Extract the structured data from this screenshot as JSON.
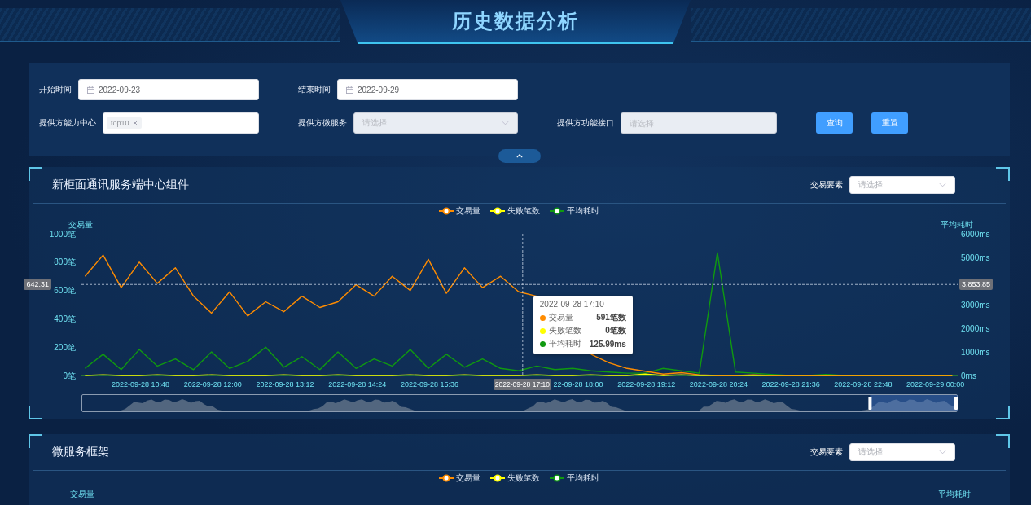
{
  "header": {
    "title": "历史数据分析"
  },
  "filters": {
    "fields": [
      {
        "label": "开始时间",
        "kind": "date",
        "value": "2022-09-23",
        "disabled": false
      },
      {
        "label": "结束时间",
        "kind": "date",
        "value": "2022-09-29",
        "disabled": false
      },
      {
        "label": "提供方能力中心",
        "kind": "tags",
        "tags": [
          "top10"
        ],
        "disabled": false
      },
      {
        "label": "提供方微服务",
        "kind": "select",
        "placeholder": "请选择",
        "disabled": true
      },
      {
        "label": "提供方功能接口",
        "kind": "input",
        "placeholder": "请选择",
        "disabled": true
      }
    ],
    "buttons": [
      "查询",
      "重置"
    ]
  },
  "panels": [
    {
      "title": "新柜面通讯服务端中心组件",
      "select": {
        "label": "交易要素",
        "placeholder": "请选择"
      },
      "chart": {
        "chart_data": {
          "type": "line",
          "legend": "top",
          "ylabel": "交易量",
          "y2label": "平均耗时",
          "ylim": [
            0,
            1000
          ],
          "y2lim": [
            0,
            6000
          ],
          "yticks": [
            {
              "value": 0,
              "label": "0笔"
            },
            {
              "value": 200,
              "label": "200笔"
            },
            {
              "value": 400,
              "label": "400笔"
            },
            {
              "value": 600,
              "label": "600笔"
            },
            {
              "value": 800,
              "label": "800笔"
            },
            {
              "value": 1000,
              "label": "1000笔"
            }
          ],
          "y2ticks": [
            {
              "value": 0,
              "label": "0ms"
            },
            {
              "value": 1000,
              "label": "1000ms"
            },
            {
              "value": 2000,
              "label": "2000ms"
            },
            {
              "value": 3000,
              "label": "3000ms"
            },
            {
              "value": 5000,
              "label": "5000ms"
            },
            {
              "value": 6000,
              "label": "6000ms"
            }
          ],
          "categories": [
            null,
            null,
            null,
            "2022-09-28 10:48",
            null,
            null,
            null,
            "2022-09-28 12:00",
            null,
            null,
            null,
            "2022-09-28 13:12",
            null,
            null,
            null,
            "2022-09-28 14:24",
            null,
            null,
            null,
            "2022-09-28 15:36",
            null,
            null,
            null,
            null,
            null,
            null,
            null,
            "22-09-28 18:00",
            null,
            null,
            null,
            "2022-09-28 19:12",
            null,
            null,
            null,
            "2022-09-28 20:24",
            null,
            null,
            null,
            "2022-09-28 21:36",
            null,
            null,
            null,
            "2022-09-28 22:48",
            null,
            null,
            null,
            "2022-09-29 00:00",
            null
          ],
          "series": [
            {
              "name": "交易量",
              "color": "#ff8c00",
              "values": [
                700,
                850,
                620,
                800,
                650,
                760,
                560,
                440,
                590,
                420,
                520,
                450,
                560,
                480,
                520,
                640,
                560,
                700,
                600,
                820,
                580,
                760,
                620,
                700,
                591,
                560,
                null,
                null,
                150,
                90,
                50,
                30,
                10,
                20,
                5,
                0,
                0,
                5,
                0,
                0,
                0,
                0,
                0,
                0,
                0,
                0,
                0,
                0,
                0
              ]
            },
            {
              "name": "失败笔数",
              "color": "#ffff00",
              "values": [
                0,
                5,
                0,
                0,
                5,
                0,
                0,
                5,
                0,
                0,
                0,
                5,
                0,
                0,
                5,
                0,
                0,
                0,
                5,
                0,
                0,
                5,
                0,
                0,
                0,
                5,
                0,
                0,
                5,
                0,
                0,
                10,
                0,
                5,
                0,
                0,
                0,
                0,
                0,
                0,
                0,
                0,
                0,
                0,
                0,
                0,
                0,
                0,
                0
              ]
            },
            {
              "name": "平均耗时",
              "color": "#109a10",
              "axis": "y2",
              "values": [
                300,
                900,
                250,
                1100,
                400,
                700,
                250,
                1000,
                300,
                600,
                1200,
                350,
                800,
                250,
                1000,
                300,
                700,
                400,
                1100,
                300,
                900,
                350,
                700,
                300,
                200,
                400,
                250,
                300,
                200,
                150,
                100,
                100,
                300,
                200,
                100,
                5200,
                150,
                100,
                50,
                0,
                0,
                50,
                0,
                0,
                0,
                0,
                0,
                0,
                0
              ]
            }
          ]
        }
      },
      "axis_pointer": {
        "x_label": "2022-09-28 17:10",
        "y_label": "642.31",
        "y2_label": "3,853.85"
      },
      "tooltip": {
        "title": "2022-09-28 17:10",
        "rows": [
          {
            "name": "交易量",
            "value": "591笔数",
            "color": "#ff8c00"
          },
          {
            "name": "失败笔数",
            "value": "0笔数",
            "color": "#ffff00"
          },
          {
            "name": "平均耗时",
            "value": "125.99ms",
            "color": "#109a10"
          }
        ]
      },
      "zoom_slider": {
        "level": 0.9
      }
    },
    {
      "title": "微服务框架",
      "select": {
        "label": "交易要素",
        "placeholder": "请选择"
      },
      "legend": [
        {
          "name": "交易量",
          "color": "#ff8c00"
        },
        {
          "name": "失败笔数",
          "color": "#ffff00"
        },
        {
          "name": "平均耗时",
          "color": "#109a10"
        }
      ],
      "axis_labels": [
        "交易量",
        "平均耗时"
      ]
    }
  ]
}
